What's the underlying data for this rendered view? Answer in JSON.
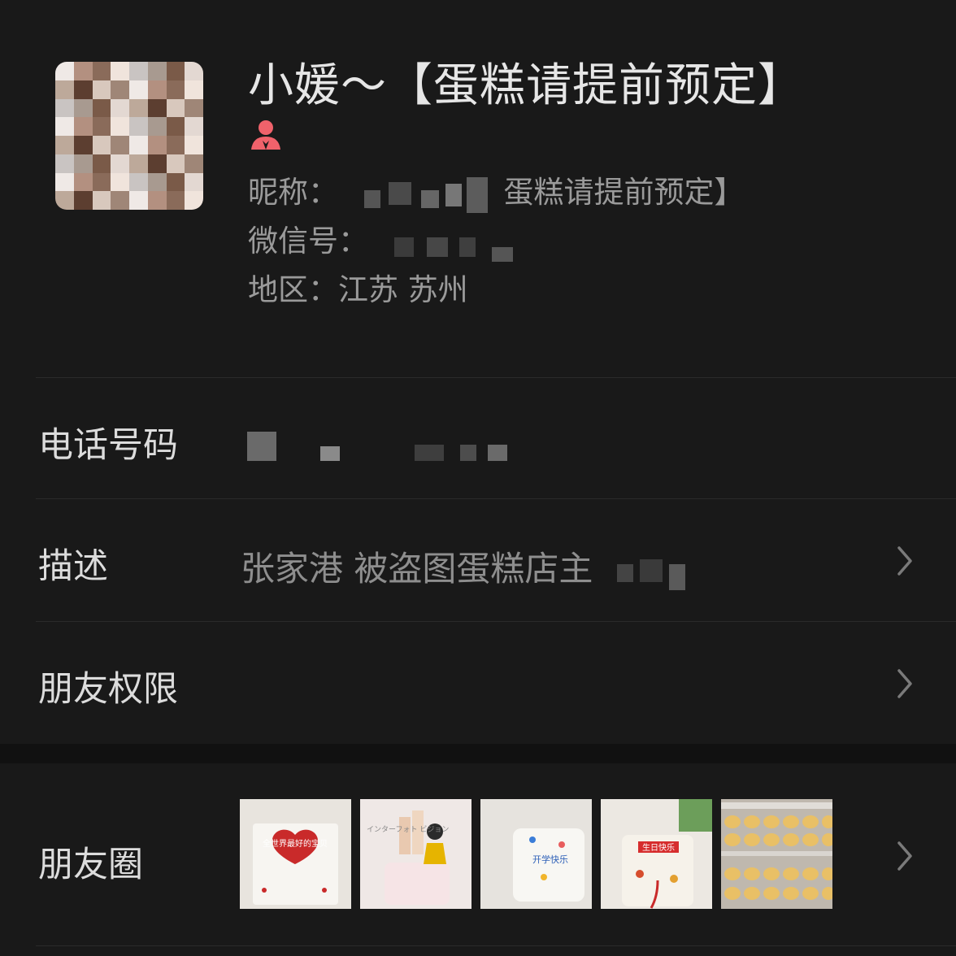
{
  "profile": {
    "name": "小媛～【蛋糕请提前预定】",
    "gender_icon": "female-icon",
    "nickname_label": "昵称：",
    "nickname_visible": "蛋糕请提前预定】",
    "wechat_id_label": "微信号：",
    "region_label": "地区：",
    "region_value": "江苏 苏州"
  },
  "rows": {
    "phone_label": "电话号码",
    "description_label": "描述",
    "description_value": "张家港 被盗图蛋糕店主",
    "permissions_label": "朋友权限",
    "moments_label": "朋友圈"
  },
  "moments": {
    "thumbnails": [
      {
        "name": "cake-red-heart-thumbnail",
        "caption": "全世界最好的宝贝"
      },
      {
        "name": "cake-princess-thumbnail",
        "caption": "インターフォト ビジョン"
      },
      {
        "name": "cake-doodle-thumbnail",
        "caption": "开学快乐"
      },
      {
        "name": "cake-birthday-thumbnail",
        "caption": "生日快乐"
      },
      {
        "name": "buns-tray-thumbnail",
        "caption": ""
      }
    ]
  },
  "colors": {
    "background": "#191919",
    "section_gap": "#111111",
    "female_icon": "#f0626b",
    "secondary_text": "#9a9a9a"
  }
}
